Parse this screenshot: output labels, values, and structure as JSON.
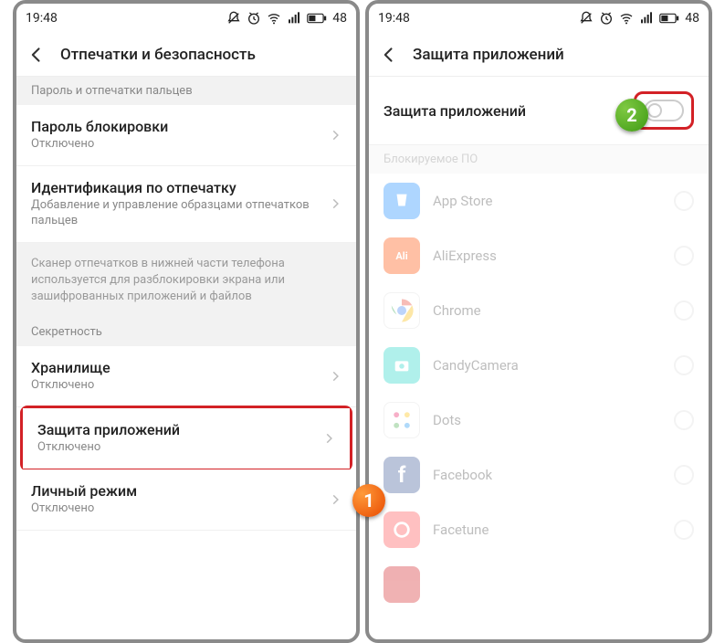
{
  "status": {
    "time": "19:48",
    "battery": "48"
  },
  "left": {
    "title": "Отпечатки и безопасность",
    "section1": "Пароль и отпечатки пальцев",
    "row1": {
      "title": "Пароль блокировки",
      "sub": "Отключено"
    },
    "row2": {
      "title": "Идентификация по отпечатку",
      "sub": "Добавление и управление образцами отпечатков пальцев"
    },
    "info": "Сканер отпечатков в нижней части телефона используется для разблокировки экрана или зашифрованных приложений и файлов",
    "section2": "Секретность",
    "row3": {
      "title": "Хранилище",
      "sub": "Отключено"
    },
    "row4": {
      "title": "Защита приложений",
      "sub": "Отключено"
    },
    "row5": {
      "title": "Личный режим",
      "sub": "Отключено"
    }
  },
  "right": {
    "title": "Защита приложений",
    "toggleLabel": "Защита приложений",
    "section": "Блокируемое ПО",
    "apps": {
      "a0": "App Store",
      "a1": "AliExpress",
      "a2": "Chrome",
      "a3": "CandyCamera",
      "a4": "Dots",
      "a5": "Facebook",
      "a6": "Facetune"
    }
  },
  "markers": {
    "m1": "1",
    "m2": "2"
  }
}
